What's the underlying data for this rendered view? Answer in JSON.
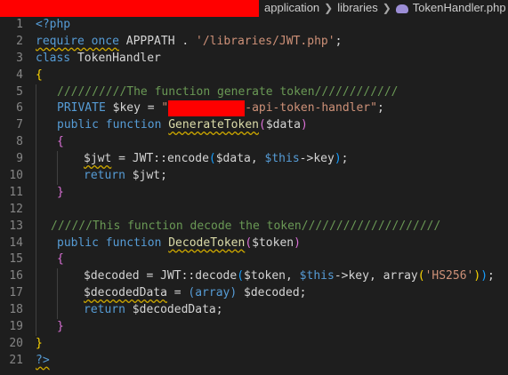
{
  "breadcrumb": {
    "items": [
      "application",
      "libraries"
    ],
    "file": "TokenHandler.php"
  },
  "code": {
    "l1": "<?php",
    "l2a": "require once",
    "l2b": " APPPATH . ",
    "l2c": "'/libraries/JWT.php'",
    "l2d": ";",
    "l3a": "class ",
    "l3b": "TokenHandler",
    "l4": "{",
    "l5": "//////////The function generate token////////////",
    "l6a": "PRIVATE",
    "l6b": " $key",
    "l6c": " = ",
    "l6d": "\"",
    "l6e": "-api-token-handler\"",
    "l6f": ";",
    "l7a": "public function ",
    "l7b": "GenerateToken",
    "l7c": "(",
    "l7d": "$data",
    "l7e": ")",
    "l8": "{",
    "l9a": "$jwt",
    "l9b": " = JWT::",
    "l9c": "encode",
    "l9d": "(",
    "l9e": "$data",
    "l9f": ", ",
    "l9g": "$this",
    "l9h": "->",
    "l9i": "key",
    "l9j": ")",
    "l9k": ";",
    "l10a": "return ",
    "l10b": "$jwt",
    "l10c": ";",
    "l11": "}",
    "l13": "//////This function decode the token////////////////////",
    "l14a": "public function ",
    "l14b": "DecodeToken",
    "l14c": "(",
    "l14d": "$token",
    "l14e": ")",
    "l15": "{",
    "l16a": "$decoded",
    "l16b": " = JWT::",
    "l16c": "decode",
    "l16d": "(",
    "l16e": "$token",
    "l16f": ", ",
    "l16g": "$this",
    "l16h": "->",
    "l16i": "key",
    "l16j": ", ",
    "l16k": "array",
    "l16l": "(",
    "l16m": "'HS256'",
    "l16n": ")",
    "l16o": ")",
    "l16p": ";",
    "l17a": "$decodedData",
    "l17b": " = ",
    "l17c": "(array)",
    "l17d": " ",
    "l17e": "$decoded",
    "l17f": ";",
    "l18a": "return ",
    "l18b": "$decodedData",
    "l18c": ";",
    "l19": "}",
    "l20": "}",
    "l21": "?>"
  },
  "colors": {
    "background": "#1e1e1e",
    "keyword": "#569cd6",
    "function": "#dcdcaa",
    "variable": "#9cdcfe",
    "string": "#ce9178",
    "comment": "#6a9955",
    "line_number": "#858585",
    "redaction": "#ff0000"
  }
}
